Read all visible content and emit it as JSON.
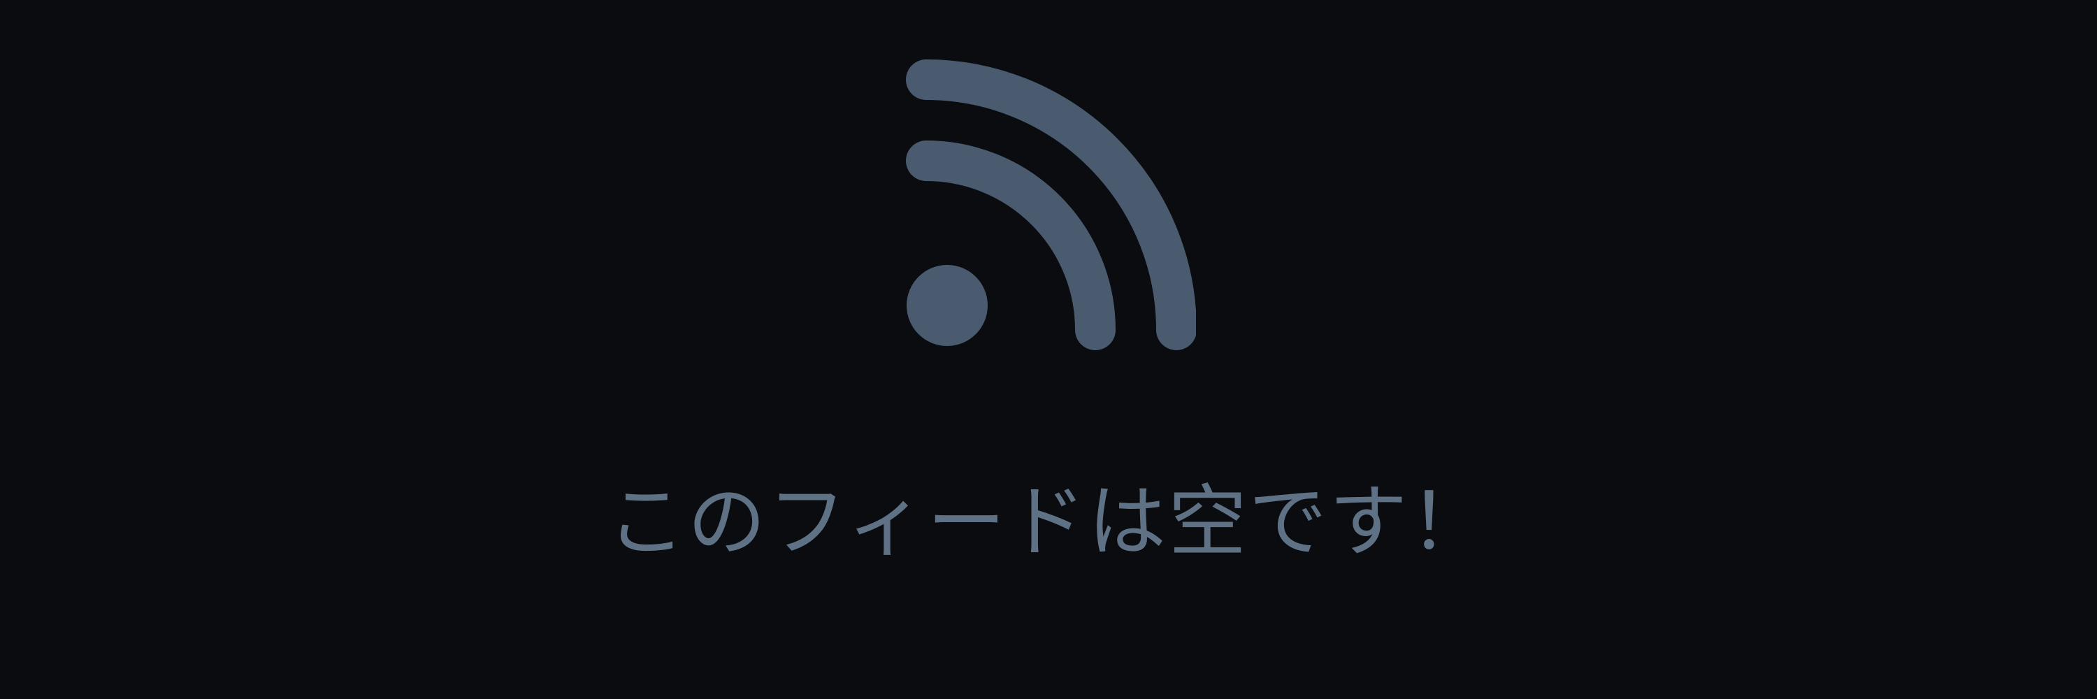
{
  "empty_state": {
    "icon": "rss-feed-icon",
    "message": "このフィードは空です！",
    "icon_color": "#4a5b6f",
    "text_color": "#5f7185",
    "background_color": "#0a0c0f"
  }
}
